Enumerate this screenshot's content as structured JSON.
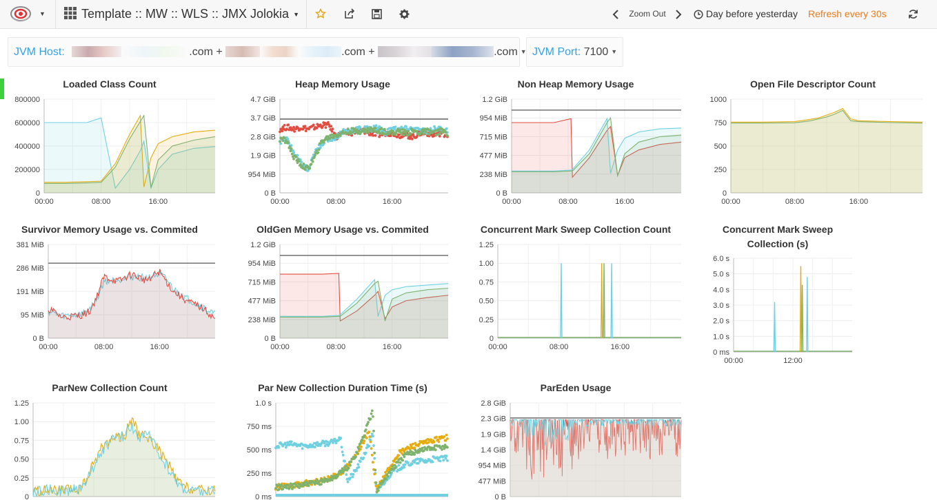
{
  "nav": {
    "title": "Template :: MW :: WLS :: JMX Jolokia",
    "zoom_out": "Zoom Out",
    "time_range": "Day before yesterday",
    "refresh": "Refresh every 30s",
    "icons": [
      "grafana-logo-icon",
      "dashboard-grid-icon",
      "star-icon",
      "share-icon",
      "save-icon",
      "gear-icon",
      "chevron-left-icon",
      "chevron-right-icon",
      "clock-icon",
      "refresh-icon"
    ]
  },
  "variables": {
    "host_label": "JVM Host:",
    "host_parts": [
      ".com +",
      ".com +",
      ".com"
    ],
    "port_label": "JVM Port:",
    "port_value": "7100"
  },
  "colors": {
    "blue": "#6ed0e0",
    "yellow": "#e5ac0e",
    "green": "#7eb26d",
    "red": "#e24d42",
    "dark": "#555555",
    "accent": "#33a2e5",
    "refresh": "#eb7b18"
  },
  "panels": [
    {
      "title": "Loaded Class Count",
      "yticks": [
        "800000",
        "600000",
        "400000",
        "200000",
        "0"
      ],
      "xticks": [
        "00:00",
        "08:00",
        "16:00"
      ],
      "chart_data": {
        "type": "area",
        "ylim": [
          0,
          800000
        ],
        "x": [
          0,
          3,
          6,
          8,
          10,
          12,
          13.5,
          14,
          15,
          16,
          18,
          21,
          24
        ],
        "series": [
          {
            "color": "blue",
            "values": [
              600000,
              600000,
              600000,
              640000,
              40000,
              200000,
              360000,
              440000,
              40000,
              200000,
              330000,
              380000,
              395000
            ]
          },
          {
            "color": "yellow",
            "values": [
              90000,
              90000,
              95000,
              100000,
              250000,
              500000,
              660000,
              50000,
              300000,
              420000,
              480000,
              520000,
              535000
            ]
          },
          {
            "color": "green",
            "values": [
              80000,
              80000,
              85000,
              90000,
              220000,
              460000,
              610000,
              660000,
              45000,
              280000,
              400000,
              450000,
              480000
            ]
          }
        ]
      }
    },
    {
      "title": "Heap Memory Usage",
      "yticks": [
        "4.7 GiB",
        "3.7 GiB",
        "2.8 GiB",
        "1.9 GiB",
        "954 MiB",
        "0 B"
      ],
      "xticks": [
        "00:00",
        "08:00",
        "16:00"
      ],
      "chart_data": {
        "type": "scatter",
        "ylim": [
          0,
          4.7
        ],
        "unit": "GiB",
        "limit": 3.7,
        "series": [
          {
            "color": "red",
            "x": [
              0,
              1,
              2,
              3,
              4,
              5,
              6,
              7,
              8,
              9,
              10,
              11,
              12,
              13,
              14,
              15,
              16,
              17,
              18,
              19,
              20,
              21,
              22,
              23,
              24
            ],
            "values": [
              3.2,
              3.3,
              3.2,
              3.3,
              3.2,
              3.3,
              3.4,
              3.4,
              2.8,
              3.0,
              3.0,
              3.1,
              3.1,
              3.0,
              2.9,
              3.0,
              3.0,
              2.9,
              2.9,
              2.8,
              3.0,
              3.0,
              2.9,
              3.0,
              2.9
            ]
          },
          {
            "color": "blue",
            "x": [
              0,
              1,
              2,
              3,
              4,
              5,
              6,
              7,
              8,
              9,
              10,
              11,
              12,
              13,
              14,
              15,
              16,
              17,
              18,
              19,
              20,
              21,
              22,
              23,
              24
            ],
            "values": [
              2.6,
              2.7,
              2.0,
              1.5,
              1.1,
              2.0,
              2.5,
              2.7,
              2.8,
              3.1,
              3.1,
              3.2,
              3.2,
              3.2,
              3.3,
              3.0,
              3.2,
              3.2,
              3.2,
              3.2,
              3.1,
              3.1,
              3.2,
              3.2,
              3.1
            ]
          },
          {
            "color": "green",
            "x": [
              0,
              1,
              2,
              3,
              4,
              5,
              6,
              7,
              8,
              9,
              10,
              11,
              12,
              13,
              14,
              15,
              16,
              17,
              18,
              19,
              20,
              21,
              22,
              23,
              24
            ],
            "values": [
              2.7,
              2.6,
              1.8,
              1.4,
              1.2,
              1.8,
              2.6,
              2.8,
              2.9,
              3.0,
              3.1,
              3.1,
              3.1,
              3.2,
              3.1,
              3.1,
              3.0,
              3.1,
              3.0,
              3.1,
              3.0,
              3.1,
              3.0,
              3.1,
              3.0
            ]
          }
        ]
      }
    },
    {
      "title": "Non Heap Memory Usage",
      "yticks": [
        "1.2 GiB",
        "954 MiB",
        "715 MiB",
        "477 MiB",
        "238 MiB",
        "0 B"
      ],
      "xticks": [
        "00:00",
        "08:00",
        "16:00"
      ],
      "chart_data": {
        "type": "area",
        "ylim": [
          0,
          1.2
        ],
        "unit": "GiB",
        "limit": 1.06,
        "x": [
          0,
          3,
          6,
          8.4,
          8.6,
          11,
          13.5,
          14,
          15,
          16,
          18,
          21,
          24
        ],
        "series": [
          {
            "color": "red",
            "values": [
              0.9,
              0.9,
              0.9,
              0.95,
              0.2,
              0.45,
              0.8,
              0.85,
              0.22,
              0.45,
              0.55,
              0.62,
              0.65
            ]
          },
          {
            "color": "blue",
            "values": [
              0.28,
              0.28,
              0.28,
              0.29,
              0.3,
              0.55,
              0.95,
              0.25,
              0.55,
              0.7,
              0.78,
              0.82,
              0.83
            ]
          },
          {
            "color": "green",
            "values": [
              0.27,
              0.27,
              0.27,
              0.28,
              0.28,
              0.5,
              0.9,
              0.96,
              0.22,
              0.5,
              0.65,
              0.72,
              0.74
            ]
          }
        ]
      }
    },
    {
      "title": "Open File Descriptor Count",
      "yticks": [
        "1000",
        "750",
        "500",
        "250",
        "0"
      ],
      "xticks": [
        "00:00",
        "08:00",
        "16:00"
      ],
      "chart_data": {
        "type": "area",
        "ylim": [
          0,
          1000
        ],
        "x": [
          0,
          4,
          8,
          10,
          11,
          12,
          13,
          14,
          15,
          16,
          20,
          24
        ],
        "series": [
          {
            "color": "yellow",
            "values": [
              755,
              755,
              760,
              785,
              800,
              830,
              860,
              900,
              790,
              770,
              760,
              755
            ]
          },
          {
            "color": "green",
            "values": [
              745,
              745,
              748,
              770,
              790,
              810,
              840,
              880,
              770,
              760,
              750,
              745
            ]
          }
        ]
      }
    },
    {
      "title": "Survivor Memory Usage vs. Commited",
      "yticks": [
        "381 MiB",
        "286 MiB",
        "191 MiB",
        "95 MiB",
        "0 B"
      ],
      "xticks": [
        "00:00",
        "08:00",
        "16:00"
      ],
      "chart_data": {
        "type": "area",
        "ylim": [
          0,
          381
        ],
        "unit": "MiB",
        "limit": 305,
        "x": [
          0,
          2,
          4,
          5,
          6,
          7,
          8,
          10,
          12,
          14,
          16,
          17,
          18,
          20,
          22,
          24
        ],
        "series": [
          {
            "color": "blue",
            "values": [
              110,
              90,
              95,
              100,
              120,
              160,
              230,
              240,
              250,
              245,
              260,
              240,
              200,
              160,
              130,
              95
            ]
          },
          {
            "color": "red",
            "values": [
              120,
              85,
              90,
              95,
              110,
              170,
              250,
              230,
              260,
              235,
              270,
              230,
              190,
              150,
              125,
              80
            ]
          }
        ]
      }
    },
    {
      "title": "OldGen Memory Usage vs. Commited",
      "yticks": [
        "1.2 GiB",
        "954 MiB",
        "715 MiB",
        "477 MiB",
        "238 MiB",
        "0 B"
      ],
      "xticks": [
        "00:00",
        "08:00",
        "16:00"
      ],
      "chart_data": {
        "type": "area",
        "ylim": [
          0,
          1.2
        ],
        "unit": "GiB",
        "limit": 1.06,
        "x": [
          0,
          3,
          6,
          8.4,
          8.6,
          11,
          13.5,
          14,
          15,
          16,
          18,
          21,
          24
        ],
        "series": [
          {
            "color": "red",
            "values": [
              0.82,
              0.82,
              0.82,
              0.83,
              0.22,
              0.35,
              0.55,
              0.6,
              0.25,
              0.4,
              0.48,
              0.52,
              0.55
            ]
          },
          {
            "color": "blue",
            "values": [
              0.28,
              0.28,
              0.28,
              0.29,
              0.3,
              0.5,
              0.75,
              0.28,
              0.55,
              0.62,
              0.66,
              0.68,
              0.7
            ]
          },
          {
            "color": "green",
            "values": [
              0.27,
              0.27,
              0.27,
              0.28,
              0.28,
              0.45,
              0.7,
              0.73,
              0.22,
              0.5,
              0.58,
              0.62,
              0.64
            ]
          }
        ]
      }
    },
    {
      "title": "Concurrent Mark Sweep Collection Count",
      "yticks": [
        "1.25",
        "1.00",
        "0.75",
        "0.50",
        "0.25",
        "0"
      ],
      "xticks": [
        "00:00",
        "08:00",
        "16:00"
      ],
      "chart_data": {
        "type": "line",
        "ylim": [
          0,
          1.25
        ],
        "spikes": [
          {
            "color": "blue",
            "x": 8.3,
            "value": 1.0
          },
          {
            "color": "yellow",
            "x": 13.6,
            "value": 1.0
          },
          {
            "color": "green",
            "x": 13.9,
            "value": 1.0
          },
          {
            "color": "blue",
            "x": 14.9,
            "value": 1.0
          }
        ]
      }
    },
    {
      "title": "Concurrent Mark Sweep Collection (s)",
      "yticks": [
        "6.0 s",
        "5.0 s",
        "4.0 s",
        "3.0 s",
        "2.0 s",
        "1.0 s",
        "0 ms"
      ],
      "xticks": [
        "00:00",
        "12:00"
      ],
      "chart_data": {
        "type": "line",
        "ylim": [
          0,
          6
        ],
        "unit": "s",
        "spikes": [
          {
            "color": "blue",
            "x": 8.3,
            "value": 3.2
          },
          {
            "color": "yellow",
            "x": 13.6,
            "value": 5.5
          },
          {
            "color": "green",
            "x": 13.9,
            "value": 4.3
          },
          {
            "color": "blue",
            "x": 14.9,
            "value": 4.8
          }
        ]
      }
    },
    {
      "title": "ParNew Collection Count",
      "yticks": [
        "1.25",
        "1.00",
        "0.75",
        "0.50",
        "0.25",
        "0"
      ],
      "xticks": [],
      "chart_data": {
        "type": "area",
        "ylim": [
          0,
          1.25
        ],
        "x": [
          0,
          2,
          4,
          6,
          7,
          8,
          9,
          10,
          11,
          12,
          13,
          14,
          15,
          16,
          17,
          18,
          19,
          20,
          22,
          24
        ],
        "series": [
          {
            "color": "yellow",
            "values": [
              0.07,
              0.08,
              0.08,
              0.09,
              0.2,
              0.45,
              0.65,
              0.75,
              0.8,
              0.8,
              1.05,
              0.8,
              0.8,
              0.7,
              0.55,
              0.4,
              0.2,
              0.12,
              0.08,
              0.08
            ]
          },
          {
            "color": "blue",
            "values": [
              0.05,
              0.09,
              0.07,
              0.1,
              0.22,
              0.4,
              0.6,
              0.72,
              0.78,
              0.82,
              0.95,
              0.78,
              0.85,
              0.68,
              0.5,
              0.35,
              0.18,
              0.1,
              0.07,
              0.07
            ]
          }
        ]
      }
    },
    {
      "title": "Par New Collection Duration Time (s)",
      "yticks": [
        "1.0 s",
        "750 ms",
        "500 ms",
        "250 ms",
        "0 ms"
      ],
      "xticks": [],
      "chart_data": {
        "type": "scatter",
        "ylim": [
          0,
          1000
        ],
        "unit": "ms",
        "series": [
          {
            "color": "blue",
            "x": [
              0,
              2,
              4,
              6,
              7,
              8,
              9,
              10,
              11,
              12,
              13,
              13.5,
              14,
              15,
              16,
              17,
              18,
              19,
              20,
              21,
              22,
              23,
              24
            ],
            "values": [
              540,
              560,
              540,
              560,
              570,
              580,
              620,
              170,
              260,
              400,
              560,
              700,
              60,
              150,
              250,
              300,
              340,
              360,
              380,
              380,
              400,
              400,
              410
            ]
          },
          {
            "color": "yellow",
            "x": [
              0,
              2,
              4,
              6,
              8,
              9,
              10,
              11,
              12,
              13,
              14,
              15,
              16,
              17,
              18,
              19,
              20,
              21,
              22,
              23,
              24
            ],
            "values": [
              100,
              120,
              140,
              160,
              210,
              250,
              320,
              420,
              560,
              700,
              60,
              200,
              330,
              450,
              500,
              540,
              560,
              580,
              600,
              620,
              630
            ]
          },
          {
            "color": "green",
            "x": [
              0,
              3,
              6,
              8,
              10,
              11,
              12,
              13,
              13.5,
              14,
              16,
              18,
              20,
              22,
              24
            ],
            "values": [
              95,
              115,
              150,
              200,
              310,
              430,
              600,
              820,
              900,
              60,
              280,
              440,
              500,
              520,
              540
            ]
          }
        ]
      }
    },
    {
      "title": "ParEden Usage",
      "yticks": [
        "2.8 GiB",
        "2.3 GiB",
        "1.9 GiB",
        "1.4 GiB",
        "954 MiB",
        "477 MiB",
        "0 B"
      ],
      "xticks": [],
      "chart_data": {
        "type": "area",
        "ylim": [
          0,
          2.8
        ],
        "unit": "GiB",
        "limit": 2.35,
        "series": [
          {
            "color": "red",
            "base": 2.3,
            "min": 0.5
          },
          {
            "color": "blue",
            "base": 2.3,
            "min": 1.5
          }
        ]
      }
    }
  ]
}
